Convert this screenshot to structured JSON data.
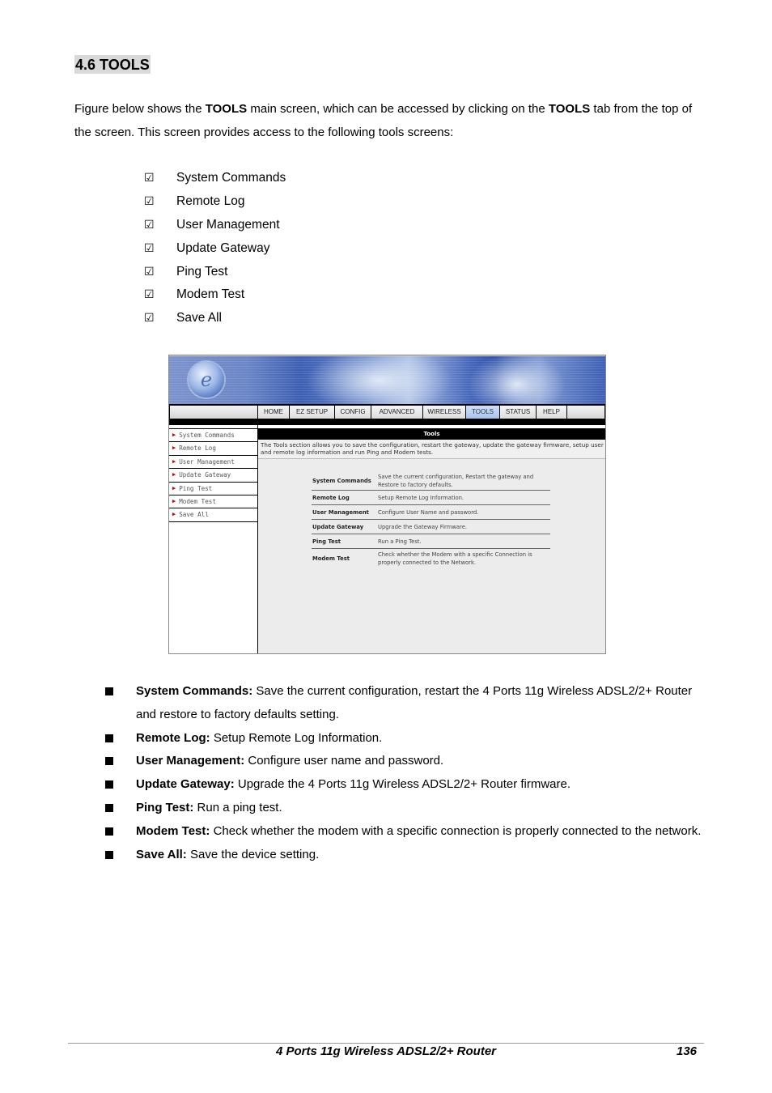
{
  "heading": "4.6 TOOLS",
  "intro": {
    "p1": "Figure below shows the ",
    "b1": "TOOLS",
    "p2": " main screen, which can be accessed by clicking on the ",
    "b2": "TOOLS",
    "p3": " tab from the top of the screen. This screen provides access to the following tools screens:"
  },
  "checklist": {
    "icon": "☑",
    "items": [
      "System Commands",
      "Remote Log",
      "User Management",
      "Update Gateway",
      "Ping Test",
      "Modem Test",
      "Save All"
    ]
  },
  "screenshot": {
    "logo_letter": "e",
    "tabs": [
      "HOME",
      "EZ SETUP",
      "CONFIG",
      "ADVANCED",
      "WIRELESS",
      "TOOLS",
      "STATUS",
      "HELP"
    ],
    "active_tab": "TOOLS",
    "sidebar": [
      "System Commands",
      "Remote Log",
      "User Management",
      "Update Gateway",
      "Ping Test",
      "Modem Test",
      "Save All"
    ],
    "sidebar_arrow": "▶",
    "panel_title": "Tools",
    "panel_desc": "The Tools section allows you to save the configuration, restart the gateway, update the gateway firmware, setup user and remote log information and run Ping and Modem tests.",
    "rows": [
      {
        "name": "System Commands",
        "desc": "Save the current configuration, Restart the gateway and Restore to factory defaults."
      },
      {
        "name": "Remote Log",
        "desc": "Setup Remote Log Information."
      },
      {
        "name": "User Management",
        "desc": "Configure User Name and password."
      },
      {
        "name": "Update Gateway",
        "desc": "Upgrade the Gateway Firmware."
      },
      {
        "name": "Ping Test",
        "desc": "Run a Ping Test."
      },
      {
        "name": "Modem Test",
        "desc": "Check whether the Modem with a specific Connection is properly connected to the Network."
      }
    ]
  },
  "bullets": [
    {
      "term": "System Commands:",
      "text": " Save the current configuration, restart the 4 Ports 11g Wireless ADSL2/2+ Router and restore to factory defaults setting."
    },
    {
      "term": "Remote Log:",
      "text": " Setup Remote Log Information."
    },
    {
      "term": "User Management:",
      "text": " Configure user name and password."
    },
    {
      "term": "Update Gateway:",
      "text": " Upgrade the 4 Ports 11g Wireless ADSL2/2+ Router firmware."
    },
    {
      "term": "Ping Test:",
      "text": " Run a ping test."
    },
    {
      "term": "Modem Test:",
      "text": " Check whether the modem with a specific connection is properly connected to the network."
    },
    {
      "term": "Save All:",
      "text": " Save the device setting."
    }
  ],
  "footer": {
    "title": "4 Ports 11g Wireless ADSL2/2+ Router",
    "page": "136"
  }
}
